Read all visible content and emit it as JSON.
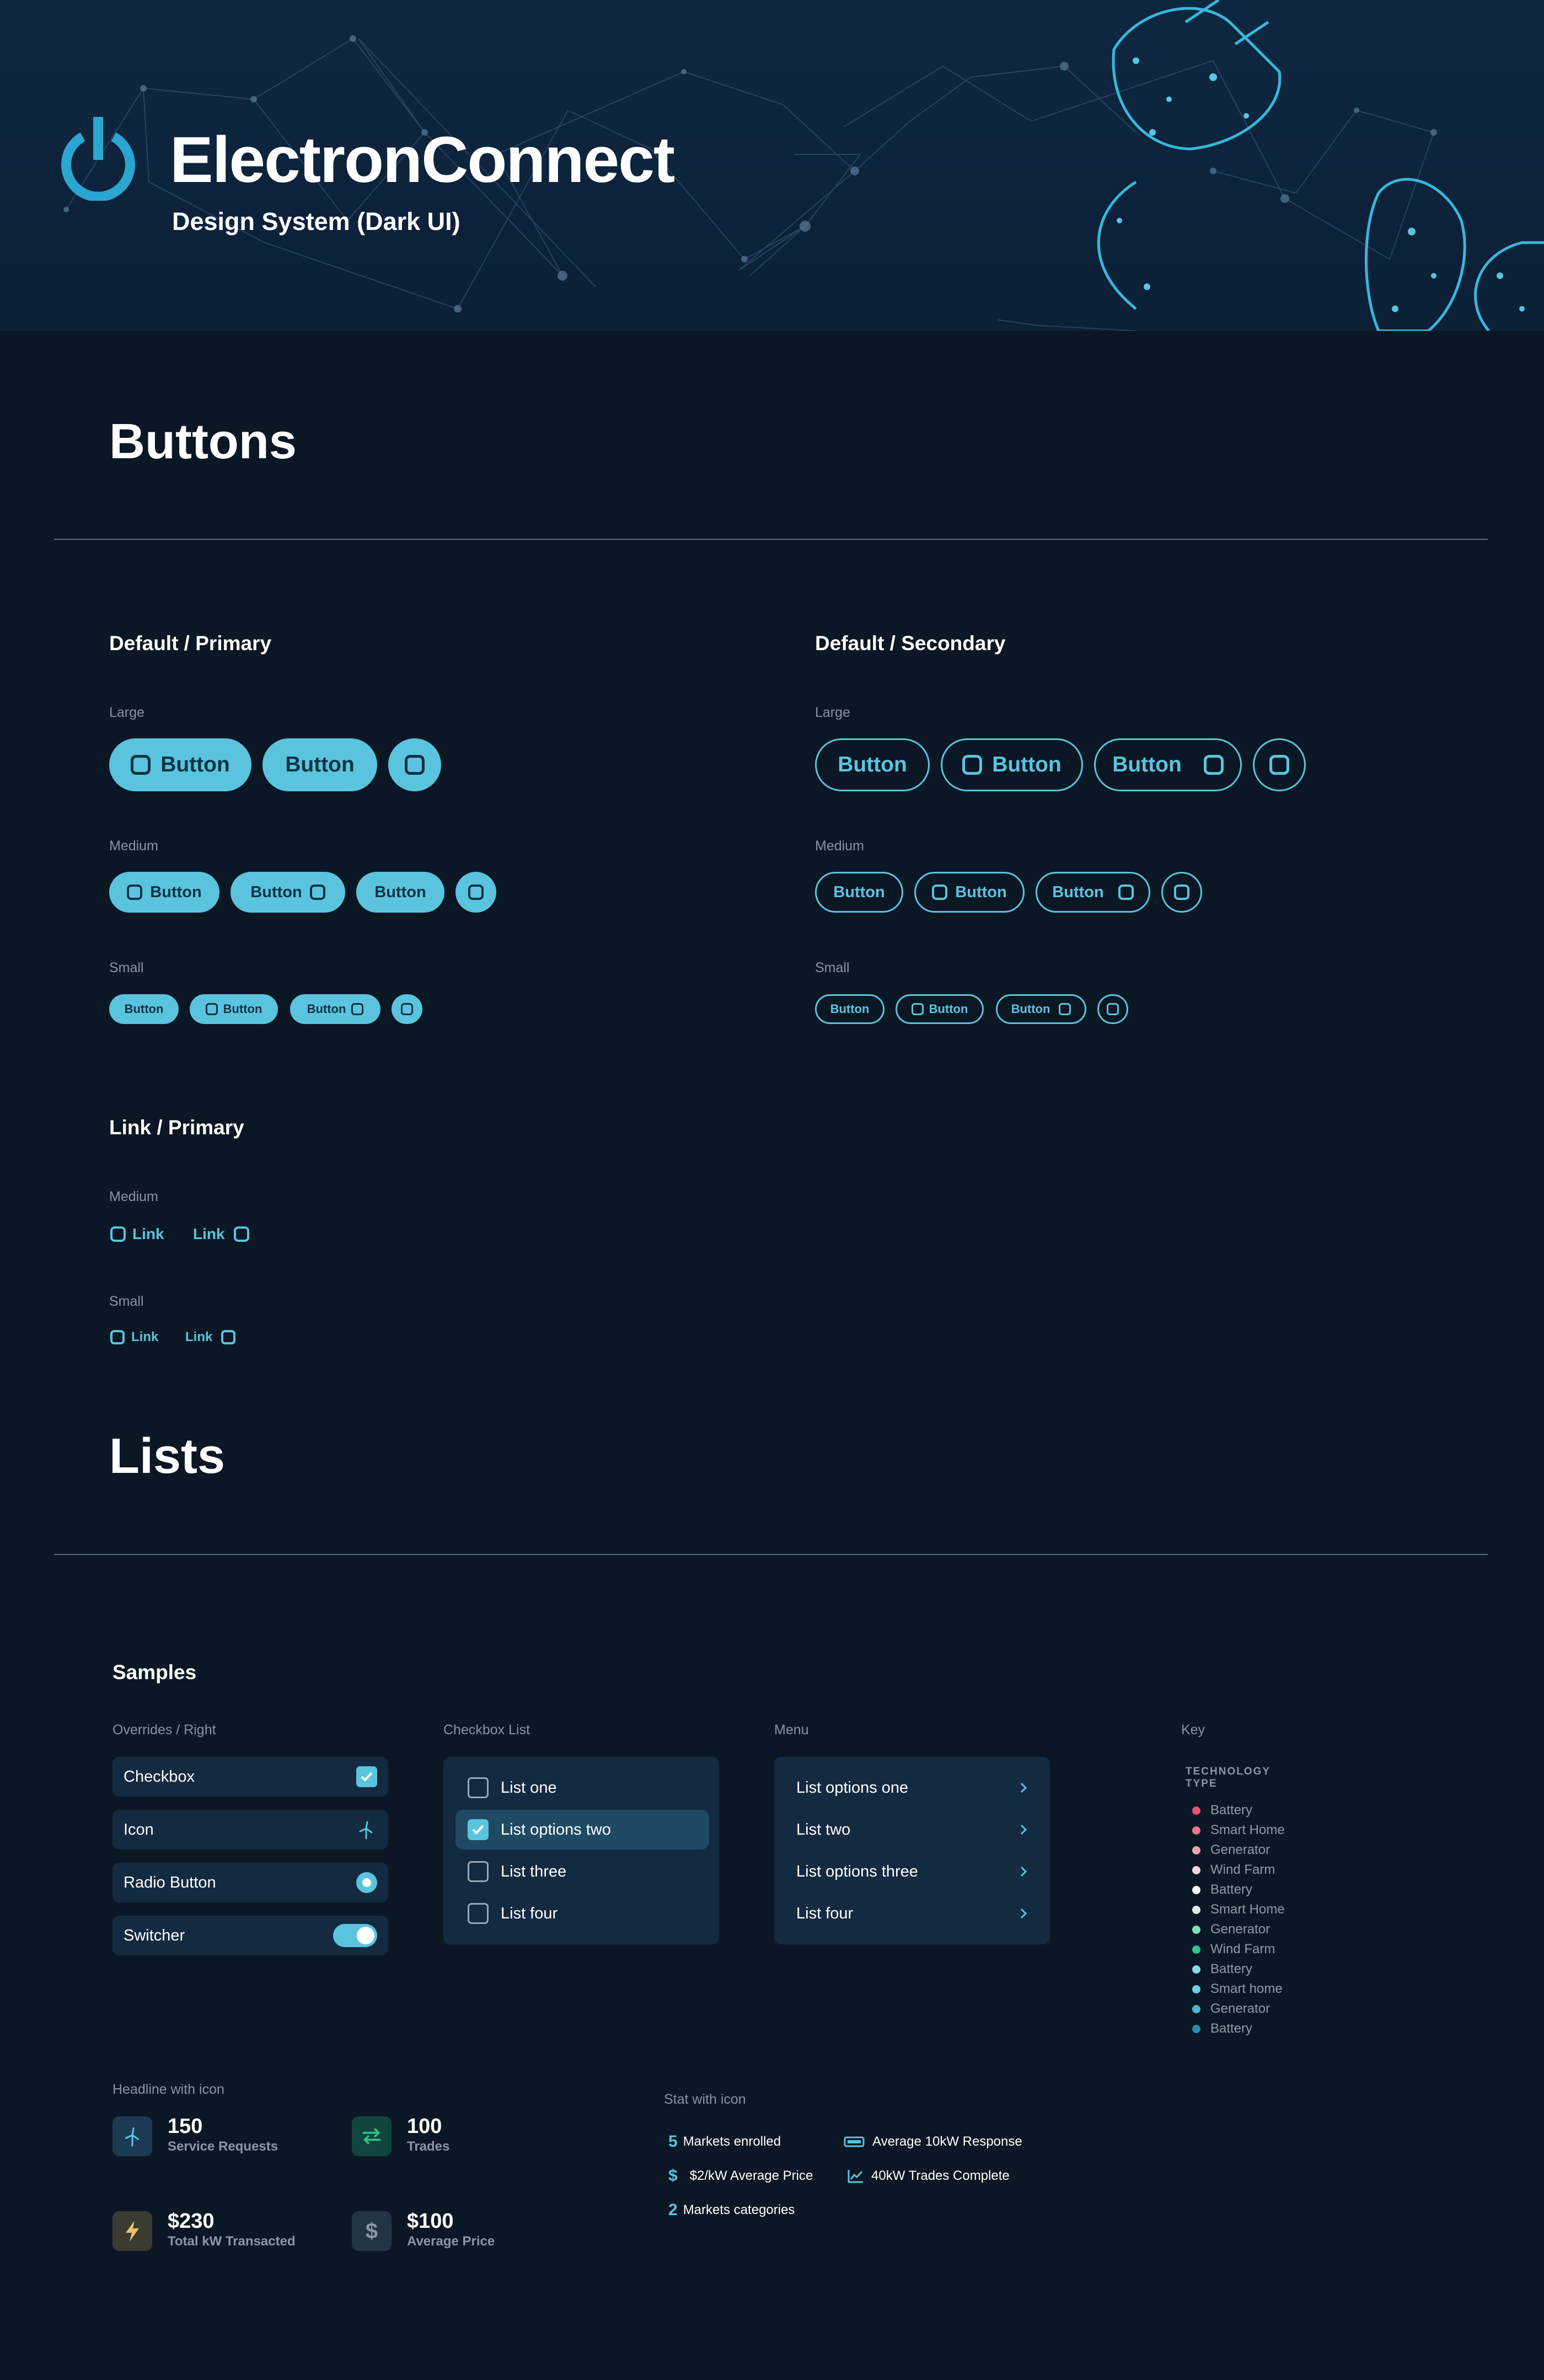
{
  "header": {
    "title": "ElectronConnect",
    "subtitle": "Design System (Dark UI)",
    "icon": "power-icon"
  },
  "buttons": {
    "section_title": "Buttons",
    "primary": {
      "title": "Default / Primary",
      "large_label": "Large",
      "medium_label": "Medium",
      "small_label": "Small",
      "button_text": "Button"
    },
    "secondary": {
      "title": "Default / Secondary",
      "large_label": "Large",
      "medium_label": "Medium",
      "small_label": "Small",
      "button_text": "Button"
    },
    "link": {
      "title": "Link / Primary",
      "medium_label": "Medium",
      "small_label": "Small",
      "link_text": "Link"
    },
    "colors": {
      "accent": "#5ac4de",
      "background": "#0b1724"
    }
  },
  "lists": {
    "section_title": "Lists",
    "samples_title": "Samples",
    "overrides": {
      "label": "Overrides / Right",
      "items": [
        "Checkbox",
        "Icon",
        "Radio Button",
        "Switcher"
      ]
    },
    "checkbox_list": {
      "label": "Checkbox List",
      "items": [
        {
          "text": "List one",
          "checked": false
        },
        {
          "text": "List options two",
          "checked": true
        },
        {
          "text": "List three",
          "checked": false
        },
        {
          "text": "List four",
          "checked": false
        }
      ]
    },
    "menu": {
      "label": "Menu",
      "items": [
        "List options one",
        "List two",
        "List options three",
        "List four"
      ]
    },
    "key": {
      "label": "Key",
      "heading_line1": "TECHNOLOGY",
      "heading_line2": "TYPE",
      "items": [
        {
          "text": "Battery",
          "color": "#e0566f"
        },
        {
          "text": "Smart Home",
          "color": "#e8738a"
        },
        {
          "text": "Generator",
          "color": "#f0a3b4"
        },
        {
          "text": "Wind Farm",
          "color": "#f7d3dc"
        },
        {
          "text": "Battery",
          "color": "#ffffff"
        },
        {
          "text": "Smart Home",
          "color": "#d4f1e6"
        },
        {
          "text": "Generator",
          "color": "#7fe0b8"
        },
        {
          "text": "Wind Farm",
          "color": "#2ec48c"
        },
        {
          "text": "Battery",
          "color": "#8ad8ec"
        },
        {
          "text": "Smart home",
          "color": "#6ccde6"
        },
        {
          "text": "Generator",
          "color": "#4cb6d4"
        },
        {
          "text": "Battery",
          "color": "#2a8cb0"
        }
      ]
    },
    "headline": {
      "label": "Headline with icon",
      "items": [
        {
          "value": "150",
          "label": "Service Requests",
          "icon": "wind-turbine-icon",
          "bg": "#1d3a55",
          "fg": "#5ac4de"
        },
        {
          "value": "100",
          "label": "Trades",
          "icon": "swap-arrows-icon",
          "bg": "#10463e",
          "fg": "#2ec48c"
        },
        {
          "value": "$230",
          "label": "Total kW Transacted",
          "icon": "lightning-icon",
          "bg": "#3b3a33",
          "fg": "#e8c16a"
        },
        {
          "value": "$100",
          "label": "Average Price",
          "icon": "dollar-icon",
          "bg": "#243445",
          "fg": "#8a97a6"
        }
      ]
    },
    "stat": {
      "label": "Stat with icon",
      "items": [
        {
          "value": "5",
          "text": "Markets enrolled"
        },
        {
          "value": "$",
          "text": "$2/kW Average Price"
        },
        {
          "value": "2",
          "text": "Markets categories"
        },
        {
          "icon": "battery-icon",
          "text": "Average 10kW Response"
        },
        {
          "icon": "line-chart-icon",
          "text": "40kW Trades Complete"
        }
      ]
    }
  }
}
